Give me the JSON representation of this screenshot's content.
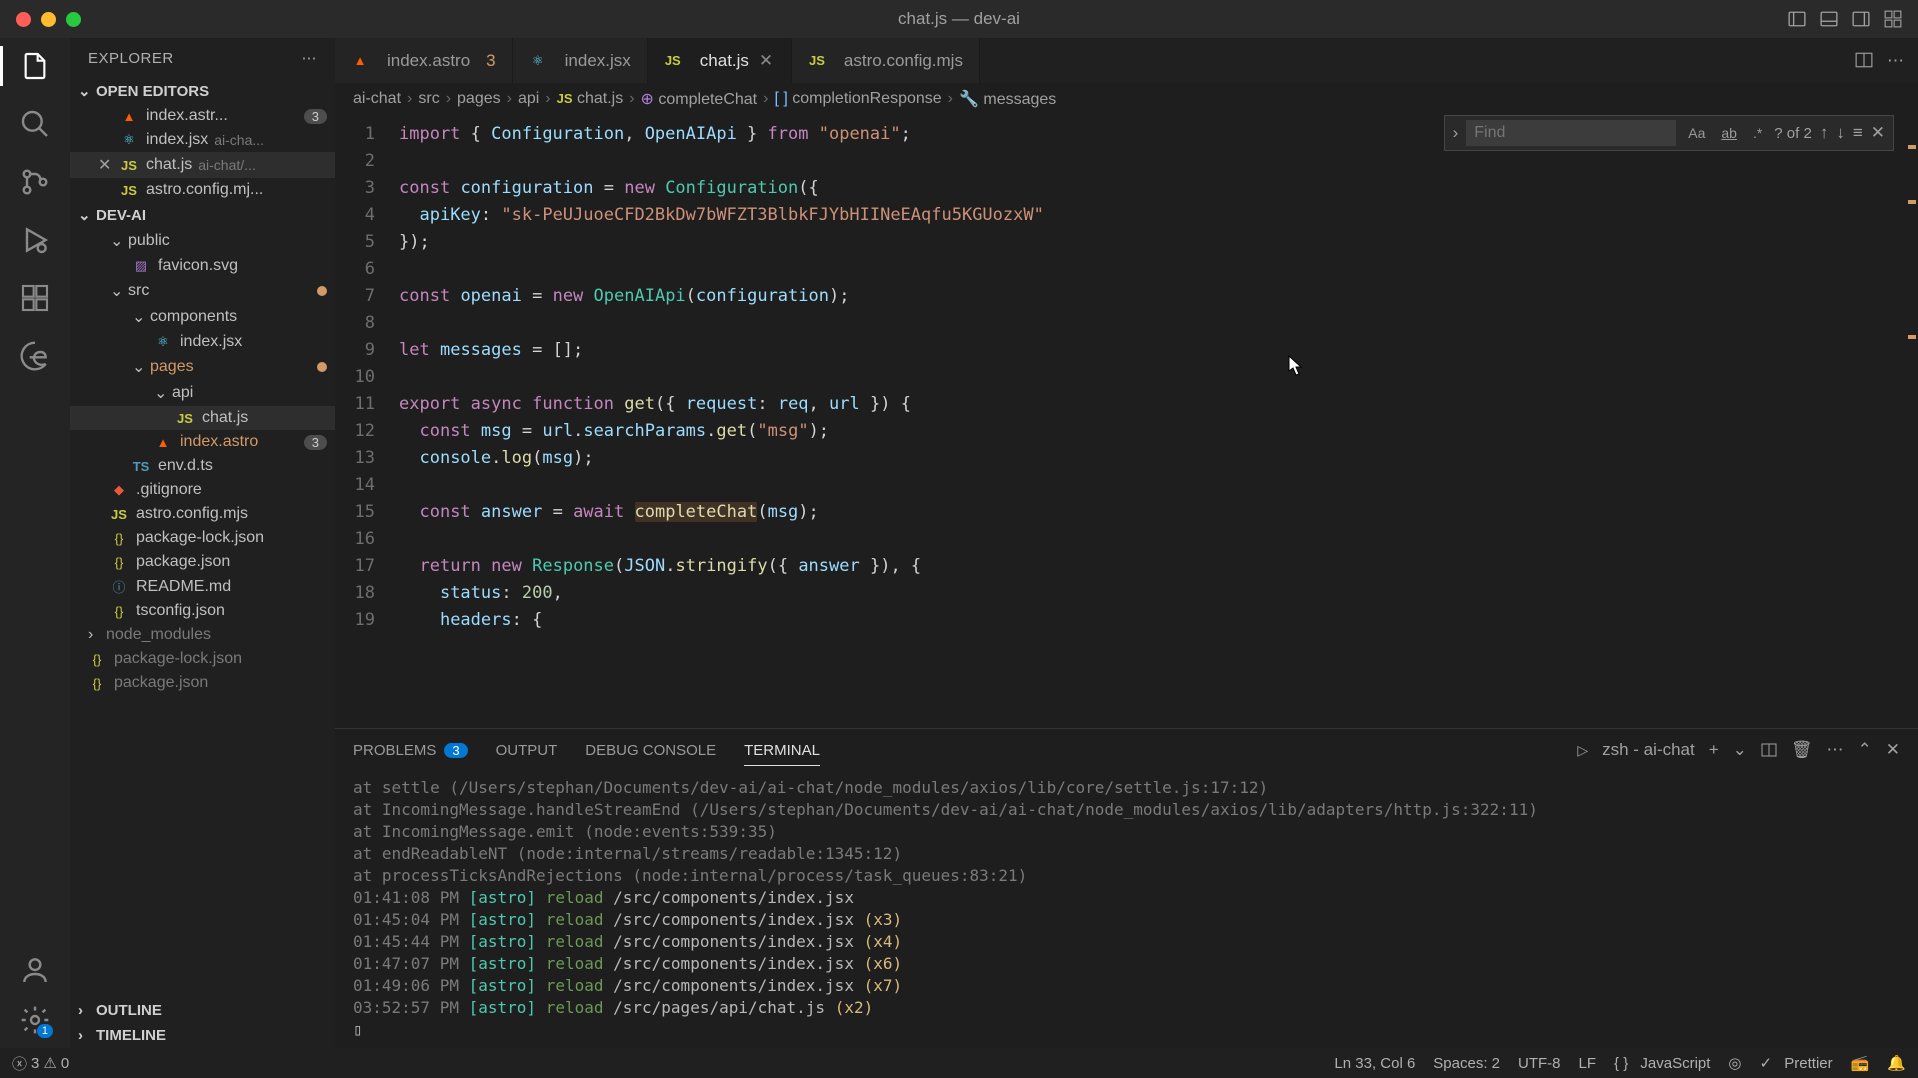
{
  "window": {
    "title": "chat.js — dev-ai"
  },
  "sidebar": {
    "title": "EXPLORER",
    "open_editors_label": "OPEN EDITORS",
    "open_editors": [
      {
        "name": "index.astr...",
        "desc": "",
        "badge": "3",
        "icon": "astro"
      },
      {
        "name": "index.jsx",
        "desc": "ai-cha...",
        "icon": "react"
      },
      {
        "name": "chat.js",
        "desc": "ai-chat/...",
        "icon": "js",
        "active": true
      },
      {
        "name": "astro.config.mj...",
        "desc": "",
        "icon": "js"
      }
    ],
    "project_label": "DEV-AI",
    "tree": [
      {
        "type": "folder",
        "name": "public",
        "depth": 1,
        "open": true
      },
      {
        "type": "file",
        "name": "favicon.svg",
        "depth": 2,
        "icon": "svg"
      },
      {
        "type": "folder",
        "name": "src",
        "depth": 1,
        "open": true,
        "git": true
      },
      {
        "type": "folder",
        "name": "components",
        "depth": 2,
        "open": true
      },
      {
        "type": "file",
        "name": "index.jsx",
        "depth": 3,
        "icon": "react"
      },
      {
        "type": "folder",
        "name": "pages",
        "depth": 2,
        "open": true,
        "git": true,
        "orange": true
      },
      {
        "type": "folder",
        "name": "api",
        "depth": 3,
        "open": true
      },
      {
        "type": "file",
        "name": "chat.js",
        "depth": 4,
        "icon": "js",
        "active": true
      },
      {
        "type": "file",
        "name": "index.astro",
        "depth": 3,
        "icon": "astro",
        "badge": "3",
        "orange": true
      },
      {
        "type": "file",
        "name": "env.d.ts",
        "depth": 2,
        "icon": "ts"
      },
      {
        "type": "file",
        "name": ".gitignore",
        "depth": 1,
        "icon": "git"
      },
      {
        "type": "file",
        "name": "astro.config.mjs",
        "depth": 1,
        "icon": "js"
      },
      {
        "type": "file",
        "name": "package-lock.json",
        "depth": 1,
        "icon": "json"
      },
      {
        "type": "file",
        "name": "package.json",
        "depth": 1,
        "icon": "json"
      },
      {
        "type": "file",
        "name": "README.md",
        "depth": 1,
        "icon": "md"
      },
      {
        "type": "file",
        "name": "tsconfig.json",
        "depth": 1,
        "icon": "json"
      },
      {
        "type": "folder",
        "name": "node_modules",
        "depth": 0,
        "open": false,
        "dim": true
      },
      {
        "type": "file",
        "name": "package-lock.json",
        "depth": 0,
        "icon": "json",
        "dim": true
      },
      {
        "type": "file",
        "name": "package.json",
        "depth": 0,
        "icon": "json",
        "dim": true
      }
    ],
    "outline_label": "OUTLINE",
    "timeline_label": "TIMELINE"
  },
  "tabs": [
    {
      "name": "index.astro",
      "icon": "astro",
      "badge": "3"
    },
    {
      "name": "index.jsx",
      "icon": "react"
    },
    {
      "name": "chat.js",
      "icon": "js",
      "active": true,
      "close": true
    },
    {
      "name": "astro.config.mjs",
      "icon": "js"
    }
  ],
  "breadcrumbs": [
    "ai-chat",
    "src",
    "pages",
    "api",
    "chat.js",
    "completeChat",
    "completionResponse",
    "messages"
  ],
  "find": {
    "placeholder": "Find",
    "count": "? of 2"
  },
  "code": {
    "lines": [
      [
        {
          "c": "tok-kw",
          "t": "import"
        },
        {
          "c": "tok-pn",
          "t": " { "
        },
        {
          "c": "tok-vr",
          "t": "Configuration"
        },
        {
          "c": "tok-pn",
          "t": ", "
        },
        {
          "c": "tok-vr",
          "t": "OpenAIApi"
        },
        {
          "c": "tok-pn",
          "t": " } "
        },
        {
          "c": "tok-kw",
          "t": "from"
        },
        {
          "c": "tok-pn",
          "t": " "
        },
        {
          "c": "tok-st",
          "t": "\"openai\""
        },
        {
          "c": "tok-pn",
          "t": ";"
        }
      ],
      [],
      [
        {
          "c": "tok-kw",
          "t": "const"
        },
        {
          "c": "tok-pn",
          "t": " "
        },
        {
          "c": "tok-vr",
          "t": "configuration"
        },
        {
          "c": "tok-pn",
          "t": " = "
        },
        {
          "c": "tok-kw",
          "t": "new"
        },
        {
          "c": "tok-pn",
          "t": " "
        },
        {
          "c": "tok-ty",
          "t": "Configuration"
        },
        {
          "c": "tok-pn",
          "t": "({"
        }
      ],
      [
        {
          "c": "tok-pn",
          "t": "  "
        },
        {
          "c": "tok-vr",
          "t": "apiKey"
        },
        {
          "c": "tok-pn",
          "t": ": "
        },
        {
          "c": "tok-st",
          "t": "\"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\""
        }
      ],
      [
        {
          "c": "tok-pn",
          "t": "});"
        }
      ],
      [],
      [
        {
          "c": "tok-kw",
          "t": "const"
        },
        {
          "c": "tok-pn",
          "t": " "
        },
        {
          "c": "tok-vr",
          "t": "openai"
        },
        {
          "c": "tok-pn",
          "t": " = "
        },
        {
          "c": "tok-kw",
          "t": "new"
        },
        {
          "c": "tok-pn",
          "t": " "
        },
        {
          "c": "tok-ty",
          "t": "OpenAIApi"
        },
        {
          "c": "tok-pn",
          "t": "("
        },
        {
          "c": "tok-vr",
          "t": "configuration"
        },
        {
          "c": "tok-pn",
          "t": ");"
        }
      ],
      [],
      [
        {
          "c": "tok-kw",
          "t": "let"
        },
        {
          "c": "tok-pn",
          "t": " "
        },
        {
          "c": "tok-vr",
          "t": "messages"
        },
        {
          "c": "tok-pn",
          "t": " = [];"
        }
      ],
      [],
      [
        {
          "c": "tok-kw",
          "t": "export"
        },
        {
          "c": "tok-pn",
          "t": " "
        },
        {
          "c": "tok-kw",
          "t": "async"
        },
        {
          "c": "tok-pn",
          "t": " "
        },
        {
          "c": "tok-kw",
          "t": "function"
        },
        {
          "c": "tok-pn",
          "t": " "
        },
        {
          "c": "tok-fn",
          "t": "get"
        },
        {
          "c": "tok-pn",
          "t": "({ "
        },
        {
          "c": "tok-vr",
          "t": "request"
        },
        {
          "c": "tok-pn",
          "t": ": "
        },
        {
          "c": "tok-vr",
          "t": "req"
        },
        {
          "c": "tok-pn",
          "t": ", "
        },
        {
          "c": "tok-vr",
          "t": "url"
        },
        {
          "c": "tok-pn",
          "t": " }) {"
        }
      ],
      [
        {
          "c": "tok-pn",
          "t": "  "
        },
        {
          "c": "tok-kw",
          "t": "const"
        },
        {
          "c": "tok-pn",
          "t": " "
        },
        {
          "c": "tok-vr",
          "t": "msg"
        },
        {
          "c": "tok-pn",
          "t": " = "
        },
        {
          "c": "tok-vr",
          "t": "url"
        },
        {
          "c": "tok-pn",
          "t": "."
        },
        {
          "c": "tok-vr",
          "t": "searchParams"
        },
        {
          "c": "tok-pn",
          "t": "."
        },
        {
          "c": "tok-fn",
          "t": "get"
        },
        {
          "c": "tok-pn",
          "t": "("
        },
        {
          "c": "tok-st",
          "t": "\"msg\""
        },
        {
          "c": "tok-pn",
          "t": ");"
        }
      ],
      [
        {
          "c": "tok-pn",
          "t": "  "
        },
        {
          "c": "tok-vr",
          "t": "console"
        },
        {
          "c": "tok-pn",
          "t": "."
        },
        {
          "c": "tok-fn",
          "t": "log"
        },
        {
          "c": "tok-pn",
          "t": "("
        },
        {
          "c": "tok-vr",
          "t": "msg"
        },
        {
          "c": "tok-pn",
          "t": ");"
        }
      ],
      [],
      [
        {
          "c": "tok-pn",
          "t": "  "
        },
        {
          "c": "tok-kw",
          "t": "const"
        },
        {
          "c": "tok-pn",
          "t": " "
        },
        {
          "c": "tok-vr",
          "t": "answer"
        },
        {
          "c": "tok-pn",
          "t": " = "
        },
        {
          "c": "tok-kw",
          "t": "await"
        },
        {
          "c": "tok-pn",
          "t": " "
        },
        {
          "c": "tok-fn hl-bg",
          "t": "completeChat"
        },
        {
          "c": "tok-pn",
          "t": "("
        },
        {
          "c": "tok-vr",
          "t": "msg"
        },
        {
          "c": "tok-pn",
          "t": ");"
        }
      ],
      [],
      [
        {
          "c": "tok-pn",
          "t": "  "
        },
        {
          "c": "tok-kw",
          "t": "return"
        },
        {
          "c": "tok-pn",
          "t": " "
        },
        {
          "c": "tok-kw",
          "t": "new"
        },
        {
          "c": "tok-pn",
          "t": " "
        },
        {
          "c": "tok-ty",
          "t": "Response"
        },
        {
          "c": "tok-pn",
          "t": "("
        },
        {
          "c": "tok-vr",
          "t": "JSON"
        },
        {
          "c": "tok-pn",
          "t": "."
        },
        {
          "c": "tok-fn",
          "t": "stringify"
        },
        {
          "c": "tok-pn",
          "t": "({ "
        },
        {
          "c": "tok-vr",
          "t": "answer"
        },
        {
          "c": "tok-pn",
          "t": " }), {"
        }
      ],
      [
        {
          "c": "tok-pn",
          "t": "    "
        },
        {
          "c": "tok-vr",
          "t": "status"
        },
        {
          "c": "tok-pn",
          "t": ": "
        },
        {
          "c": "tok-nm",
          "t": "200"
        },
        {
          "c": "tok-pn",
          "t": ","
        }
      ],
      [
        {
          "c": "tok-pn",
          "t": "    "
        },
        {
          "c": "tok-vr",
          "t": "headers"
        },
        {
          "c": "tok-pn",
          "t": ": {"
        }
      ]
    ]
  },
  "panel": {
    "tabs": {
      "problems": "PROBLEMS",
      "problems_badge": "3",
      "output": "OUTPUT",
      "debug": "DEBUG CONSOLE",
      "terminal": "TERMINAL"
    },
    "shell": "zsh - ai-chat",
    "terminal_lines": [
      {
        "pre": "    at settle (/Users/stephan/Documents/dev-ai/ai-chat/node_modules/axios/lib/core/settle.js:17:12)"
      },
      {
        "pre": "    at IncomingMessage.handleStreamEnd (/Users/stephan/Documents/dev-ai/ai-chat/node_modules/axios/lib/adapters/http.js:322:11)"
      },
      {
        "pre": "    at IncomingMessage.emit (node:events:539:35)"
      },
      {
        "pre": "    at endReadableNT (node:internal/streams/readable:1345:12)"
      },
      {
        "pre": "    at processTicksAndRejections (node:internal/process/task_queues:83:21)"
      },
      {
        "ts": "01:41:08 PM",
        "tag": "[astro]",
        "act": "reload",
        "path": "/src/components/index.jsx",
        "suf": ""
      },
      {
        "ts": "01:45:04 PM",
        "tag": "[astro]",
        "act": "reload",
        "path": "/src/components/index.jsx",
        "suf": "(x3)"
      },
      {
        "ts": "01:45:44 PM",
        "tag": "[astro]",
        "act": "reload",
        "path": "/src/components/index.jsx",
        "suf": "(x4)"
      },
      {
        "ts": "01:47:07 PM",
        "tag": "[astro]",
        "act": "reload",
        "path": "/src/components/index.jsx",
        "suf": "(x6)"
      },
      {
        "ts": "01:49:06 PM",
        "tag": "[astro]",
        "act": "reload",
        "path": "/src/components/index.jsx",
        "suf": "(x7)"
      },
      {
        "ts": "03:52:57 PM",
        "tag": "[astro]",
        "act": "reload",
        "path": "/src/pages/api/chat.js",
        "suf": "(x2)"
      }
    ]
  },
  "status": {
    "errors": "3",
    "warnings": "0",
    "ln_col": "Ln 33, Col 6",
    "spaces": "Spaces: 2",
    "encoding": "UTF-8",
    "eol": "LF",
    "lang": "JavaScript",
    "prettier": "Prettier"
  },
  "scm_badge": "1"
}
